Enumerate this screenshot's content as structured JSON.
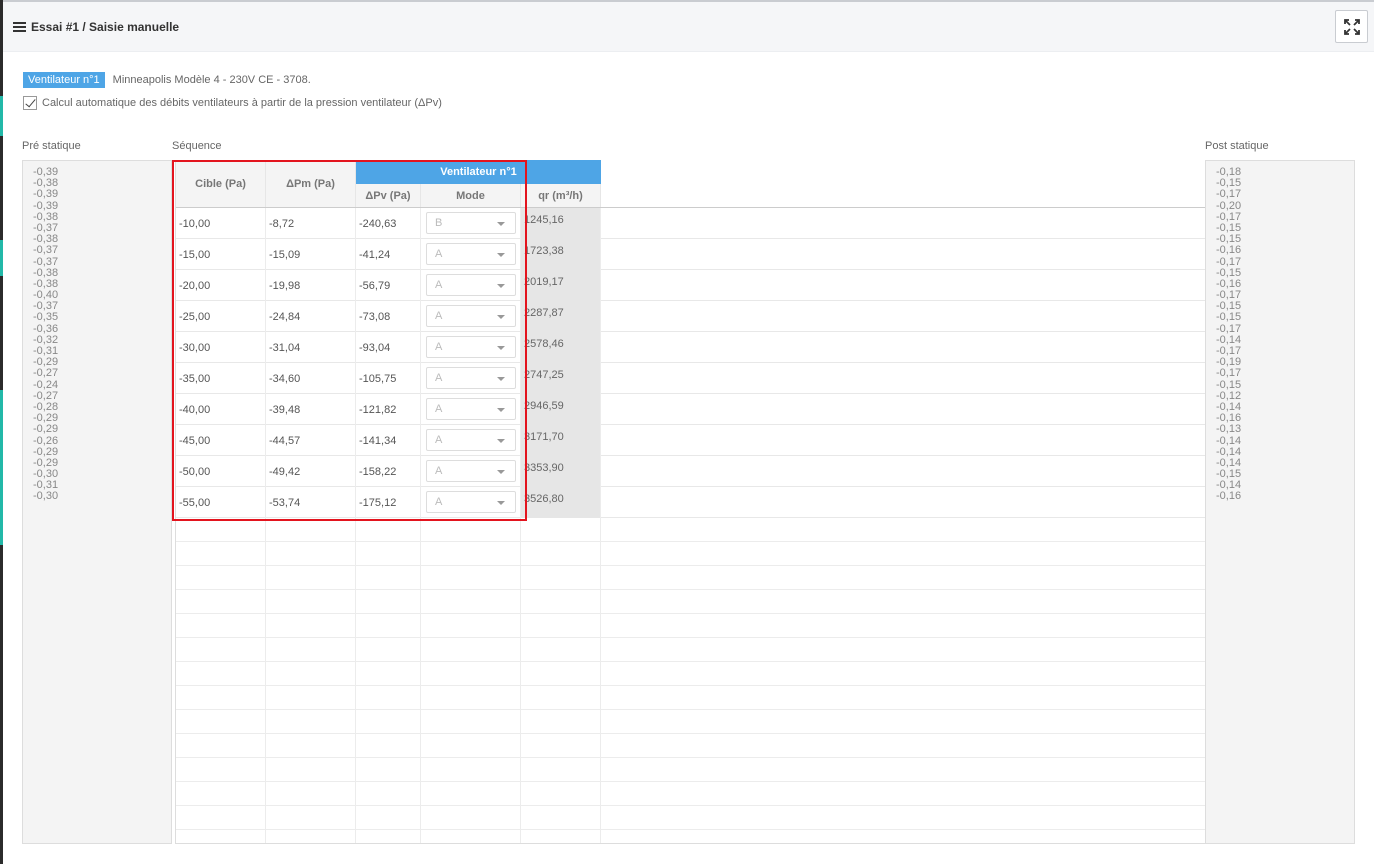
{
  "panel": {
    "title": "Essai #1 / Saisie manuelle"
  },
  "fan_info": {
    "badge": "Ventilateur n°1",
    "model": "Minneapolis Modèle 4 - 230V CE - 3708."
  },
  "auto_calc": {
    "checked": true,
    "label": "Calcul automatique des débits ventilateurs à partir de la pression ventilateur (ΔPv)"
  },
  "labels": {
    "pre_static": "Pré statique",
    "sequence": "Séquence",
    "post_static": "Post statique"
  },
  "pre_static": [
    "-0,39",
    "-0,38",
    "-0,39",
    "-0,39",
    "-0,38",
    "-0,37",
    "-0,38",
    "-0,37",
    "-0,37",
    "-0,38",
    "-0,38",
    "-0,40",
    "-0,37",
    "-0,35",
    "-0,36",
    "-0,32",
    "-0,31",
    "-0,29",
    "-0,27",
    "-0,24",
    "-0,27",
    "-0,28",
    "-0,29",
    "-0,29",
    "-0,26",
    "-0,29",
    "-0,29",
    "-0,30",
    "-0,31",
    "-0,30"
  ],
  "post_static": [
    "-0,18",
    "-0,15",
    "-0,17",
    "-0,20",
    "-0,17",
    "-0,15",
    "-0,15",
    "-0,16",
    "-0,17",
    "-0,15",
    "-0,16",
    "-0,17",
    "-0,15",
    "-0,15",
    "-0,17",
    "-0,14",
    "-0,17",
    "-0,19",
    "-0,17",
    "-0,15",
    "-0,12",
    "-0,14",
    "-0,16",
    "-0,13",
    "-0,14",
    "-0,14",
    "-0,14",
    "-0,15",
    "-0,14",
    "-0,16"
  ],
  "table": {
    "headers": {
      "cible": "Cible (Pa)",
      "dpm": "ΔPm (Pa)",
      "fan_group": "Ventilateur n°1",
      "dpv": "ΔPv (Pa)",
      "mode": "Mode",
      "qr": "qr (m³/h)"
    },
    "rows": [
      {
        "cible": "-10,00",
        "dpm": "-8,72",
        "dpv": "-240,63",
        "mode": "B",
        "qr": "1245,16"
      },
      {
        "cible": "-15,00",
        "dpm": "-15,09",
        "dpv": "-41,24",
        "mode": "A",
        "qr": "1723,38"
      },
      {
        "cible": "-20,00",
        "dpm": "-19,98",
        "dpv": "-56,79",
        "mode": "A",
        "qr": "2019,17"
      },
      {
        "cible": "-25,00",
        "dpm": "-24,84",
        "dpv": "-73,08",
        "mode": "A",
        "qr": "2287,87"
      },
      {
        "cible": "-30,00",
        "dpm": "-31,04",
        "dpv": "-93,04",
        "mode": "A",
        "qr": "2578,46"
      },
      {
        "cible": "-35,00",
        "dpm": "-34,60",
        "dpv": "-105,75",
        "mode": "A",
        "qr": "2747,25"
      },
      {
        "cible": "-40,00",
        "dpm": "-39,48",
        "dpv": "-121,82",
        "mode": "A",
        "qr": "2946,59"
      },
      {
        "cible": "-45,00",
        "dpm": "-44,57",
        "dpv": "-141,34",
        "mode": "A",
        "qr": "3171,70"
      },
      {
        "cible": "-50,00",
        "dpm": "-49,42",
        "dpv": "-158,22",
        "mode": "A",
        "qr": "3353,90"
      },
      {
        "cible": "-55,00",
        "dpm": "-53,74",
        "dpv": "-175,12",
        "mode": "A",
        "qr": "3526,80"
      }
    ]
  },
  "colors": {
    "accent": "#4ea5e6",
    "highlight": "#e3141e",
    "rail": "#22b8a8"
  }
}
